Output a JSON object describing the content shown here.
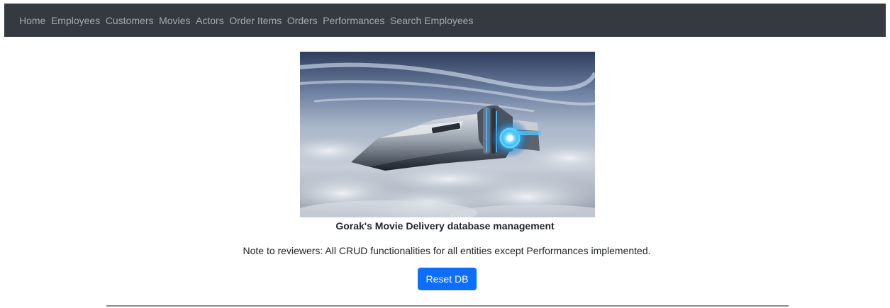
{
  "nav": {
    "items": [
      {
        "label": "Home"
      },
      {
        "label": "Employees"
      },
      {
        "label": "Customers"
      },
      {
        "label": "Movies"
      },
      {
        "label": "Actors"
      },
      {
        "label": "Order Items"
      },
      {
        "label": "Orders"
      },
      {
        "label": "Performances"
      },
      {
        "label": "Search Employees"
      }
    ]
  },
  "hero": {
    "image_icon": "spaceship-image"
  },
  "main": {
    "caption": "Gorak's Movie Delivery database management",
    "note": "Note to reviewers: All CRUD functionalities for all entities except Performances implemented.",
    "reset_label": "Reset DB"
  },
  "colors": {
    "navbar_bg": "#343a40",
    "nav_text": "#9a9da0",
    "button_primary": "#0d6efd",
    "divider": "#8a8a8f"
  }
}
